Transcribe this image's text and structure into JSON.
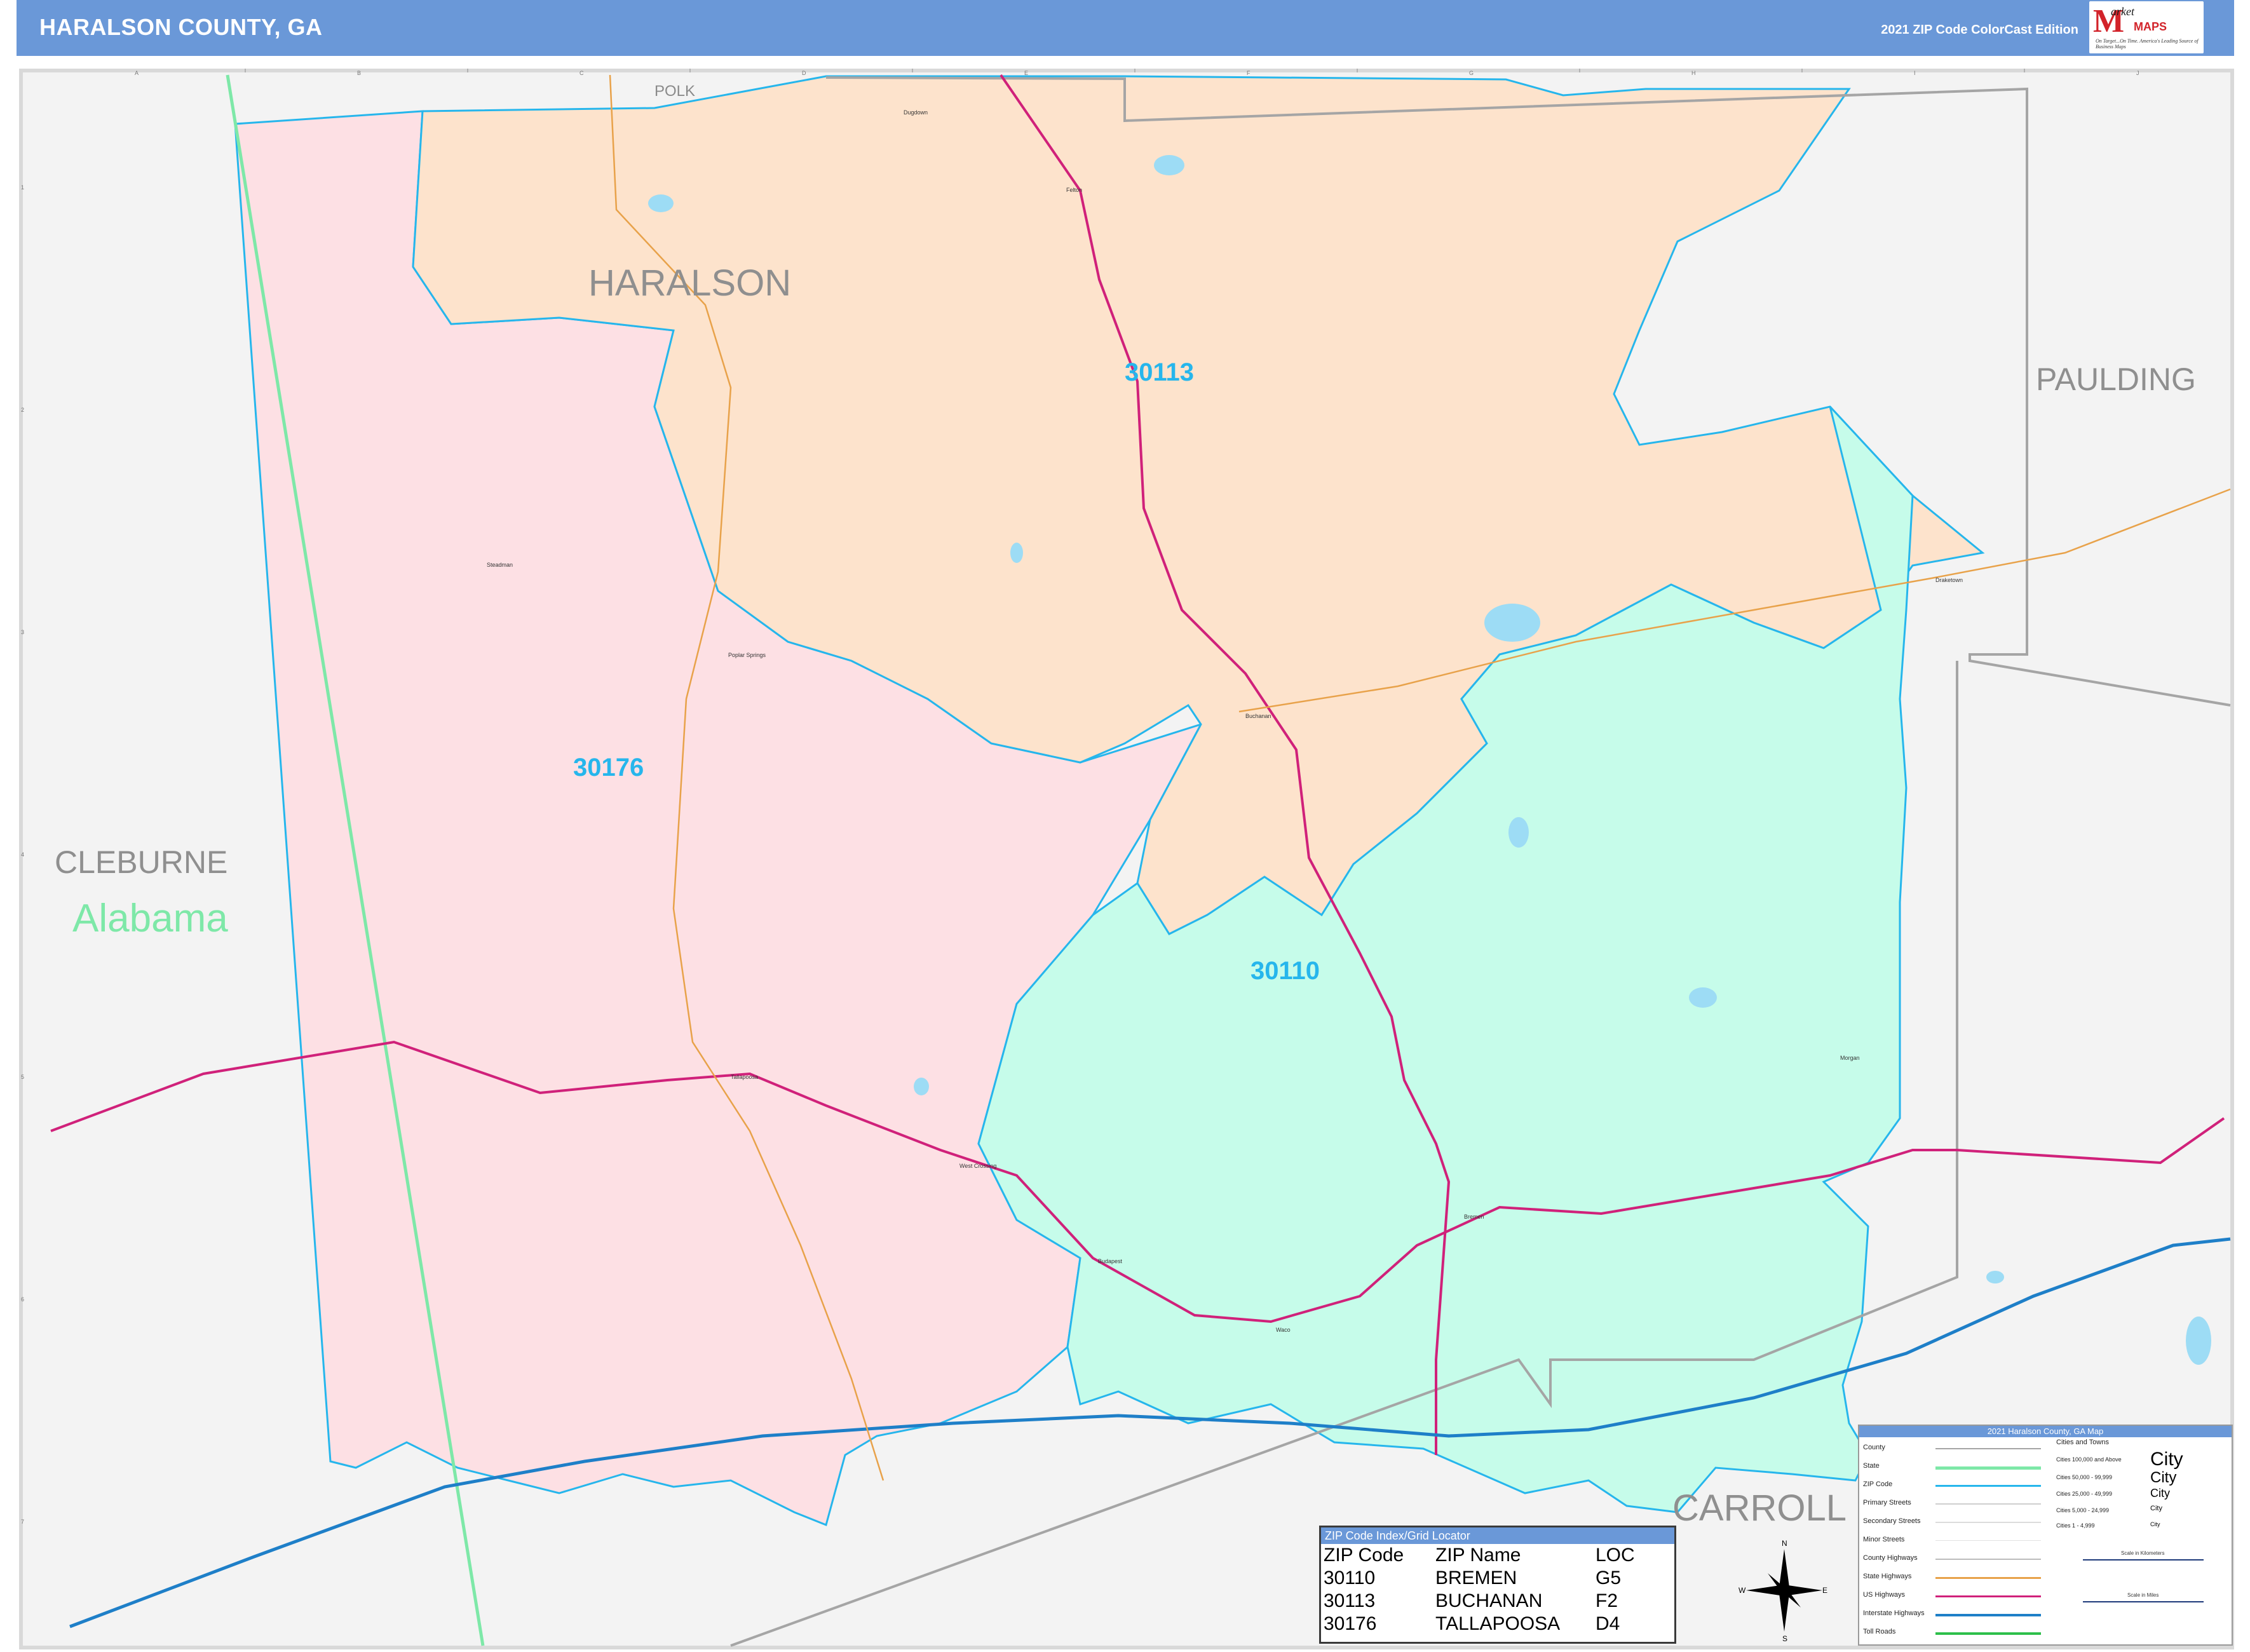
{
  "header": {
    "title": "HARALSON COUNTY, GA",
    "edition": "2021 ZIP Code ColorCast Edition",
    "logo_text_1": "arket",
    "logo_text_2": "MAPS",
    "logo_tagline": "On Target...On Time. America's Leading Source of Business Maps"
  },
  "grid": {
    "columns": [
      "A",
      "B",
      "C",
      "D",
      "E",
      "F",
      "G",
      "H",
      "I",
      "J"
    ],
    "rows": [
      "1",
      "2",
      "3",
      "4",
      "5",
      "6",
      "7"
    ]
  },
  "map": {
    "county_labels": {
      "haralson": "HARALSON",
      "paulding": "PAULDING",
      "cleburne": "CLEBURNE",
      "carroll": "CARROLL",
      "polk": "POLK"
    },
    "state_label": "Alabama",
    "zip_labels": {
      "z30113": "30113",
      "z30176": "30176",
      "z30110": "30110"
    },
    "towns": {
      "dugdown": "Dugdown",
      "felton": "Felton",
      "steadman": "Steadman",
      "poplar_springs": "Poplar Springs",
      "buchanan": "Buchanan",
      "draketown": "Draketown",
      "tallapoosa": "Tallapoosa",
      "west_crossing": "West Crossing",
      "budapest": "Budapest",
      "waco": "Waco",
      "bremen": "Bremen",
      "morgan": "Morgan"
    },
    "zip_colors": {
      "z30113": "#fde3cc",
      "z30176": "#fde0e4",
      "z30110": "#c6fcea"
    }
  },
  "zip_index": {
    "title": "ZIP Code Index/Grid Locator",
    "headers": [
      "ZIP Code",
      "ZIP Name",
      "LOC"
    ],
    "rows": [
      [
        "30110",
        "BREMEN",
        "G5"
      ],
      [
        "30113",
        "BUCHANAN",
        "F2"
      ],
      [
        "30176",
        "TALLAPOOSA",
        "D4"
      ]
    ]
  },
  "legend": {
    "title": "2021 Haralson County, GA Map",
    "items": [
      "County",
      "State",
      "ZIP Code",
      "Primary Streets",
      "Secondary Streets",
      "Minor Streets",
      "County Highways",
      "State Highways",
      "US Highways",
      "Interstate Highways",
      "Toll Roads"
    ],
    "cities_title": "Cities and Towns",
    "cities": [
      "Cities 100,000 and Above",
      "Cities 50,000 - 99,999",
      "Cities 25,000 - 49,999",
      "Cities 5,000 - 24,999",
      "Cities 1 - 4,999"
    ],
    "city_sample": "City",
    "scale_km": "Scale in Kilometers",
    "scale_mi": "Scale in Miles"
  },
  "compass": {
    "n": "N",
    "s": "S",
    "e": "E",
    "w": "W"
  }
}
